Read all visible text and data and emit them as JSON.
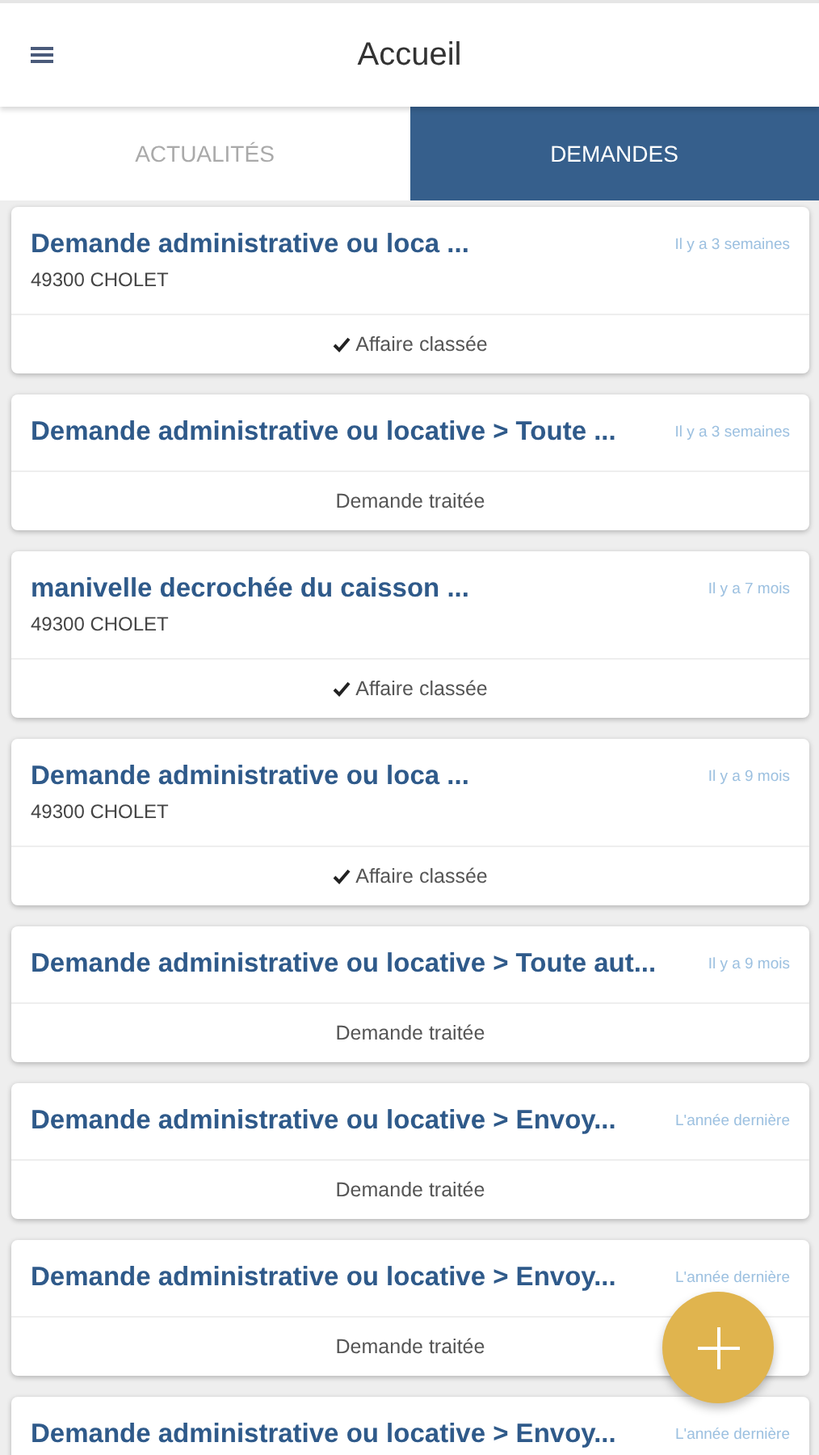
{
  "header": {
    "title": "Accueil"
  },
  "tabs": [
    {
      "label": "ACTUALITÉS",
      "selected": false
    },
    {
      "label": "DEMANDES",
      "selected": true
    }
  ],
  "requests": [
    {
      "title": "Demande administrative ou loca ...",
      "address": "49300 CHOLET",
      "time": "Il y a 3 semaines",
      "status": "Affaire classée",
      "closed": true
    },
    {
      "title": "Demande administrative ou locative > Toute ...",
      "time": "Il y a 3 semaines",
      "status": "Demande traitée",
      "closed": false
    },
    {
      "title": "manivelle decrochée du caisson ...",
      "address": "49300 CHOLET",
      "time": "Il y a 7 mois",
      "status": "Affaire classée",
      "closed": true
    },
    {
      "title": "Demande administrative ou loca ...",
      "address": "49300 CHOLET",
      "time": "Il y a 9 mois",
      "status": "Affaire classée",
      "closed": true
    },
    {
      "title": "Demande administrative ou locative > Toute aut...",
      "time": "Il y a 9 mois",
      "status": "Demande traitée",
      "closed": false
    },
    {
      "title": "Demande administrative ou locative > Envoy...",
      "time": "L'année dernière",
      "status": "Demande traitée",
      "closed": false
    },
    {
      "title": "Demande administrative ou locative > Envoy...",
      "time": "L'année dernière",
      "status": "Demande traitée",
      "closed": false
    },
    {
      "title": "Demande administrative ou locative > Envoy...",
      "time": "L'année dernière"
    }
  ]
}
